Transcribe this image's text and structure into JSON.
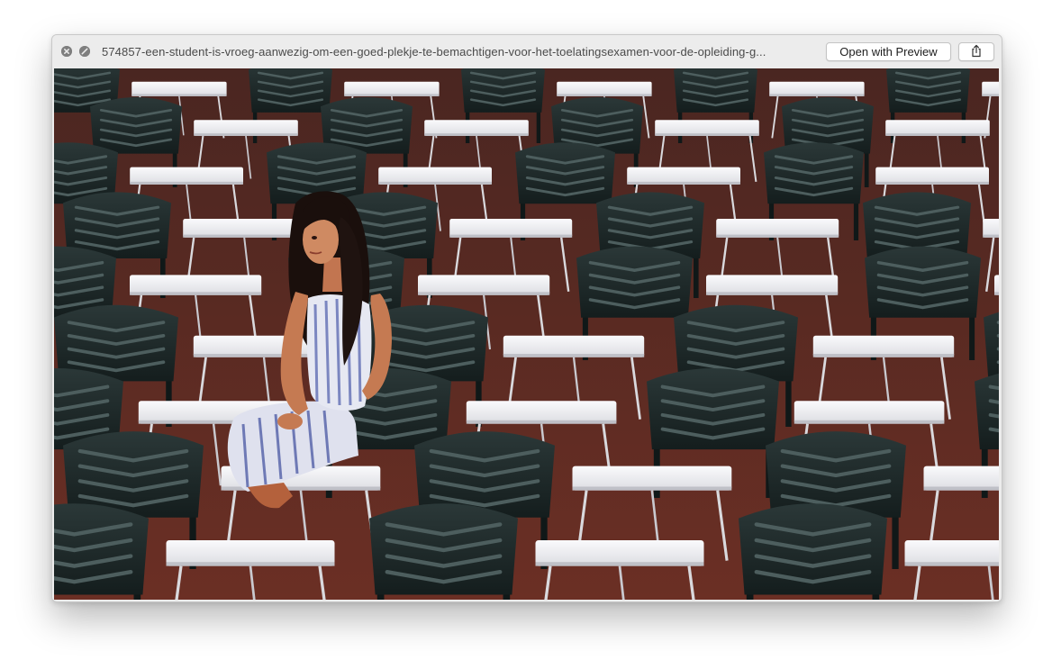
{
  "window": {
    "title": "574857-een-student-is-vroeg-aanwezig-om-een-goed-plekje-te-bemachtigen-voor-het-toelatingsexamen-voor-de-opleiding-g..."
  },
  "toolbar": {
    "open_with_label": "Open with Preview",
    "share_icon": "share-icon"
  },
  "controls": {
    "close_icon": "close-icon",
    "fullscreen_icon": "fullscreen-icon"
  },
  "photo": {
    "subject": "student-seated-among-empty-chairs-and-desks"
  },
  "colors": {
    "titlebar": "#ececec",
    "chair": "#1f2b2b",
    "desk": "#f2f2f4",
    "floor": "#5b2a22"
  }
}
